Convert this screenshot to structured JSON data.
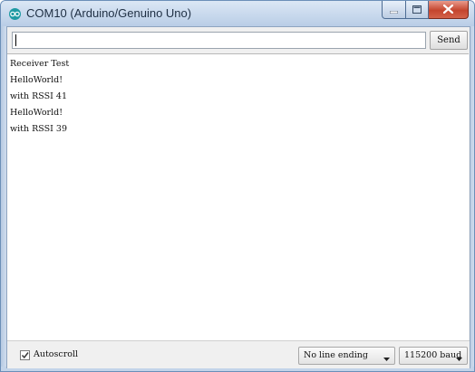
{
  "window": {
    "title": "COM10 (Arduino/Genuino Uno)"
  },
  "send_bar": {
    "input_value": "",
    "send_label": "Send"
  },
  "output": {
    "lines": [
      "Receiver Test",
      "HelloWorld!",
      "with RSSI 41",
      "HelloWorld!",
      "with RSSI 39"
    ]
  },
  "status_bar": {
    "autoscroll_label": "Autoscroll",
    "autoscroll_checked": true,
    "line_ending_selected": "No line ending",
    "baud_selected": "115200 baud"
  },
  "colors": {
    "title_bar": "#c5d6ea",
    "close_button": "#c4452e",
    "app_icon": "#1f9aa3"
  },
  "icons": {
    "app": "arduino-infinity-icon",
    "minimize": "minimize-icon",
    "maximize": "maximize-icon",
    "close": "close-icon",
    "checkbox": "checkmark-icon",
    "dropdown": "chevron-down-icon"
  }
}
